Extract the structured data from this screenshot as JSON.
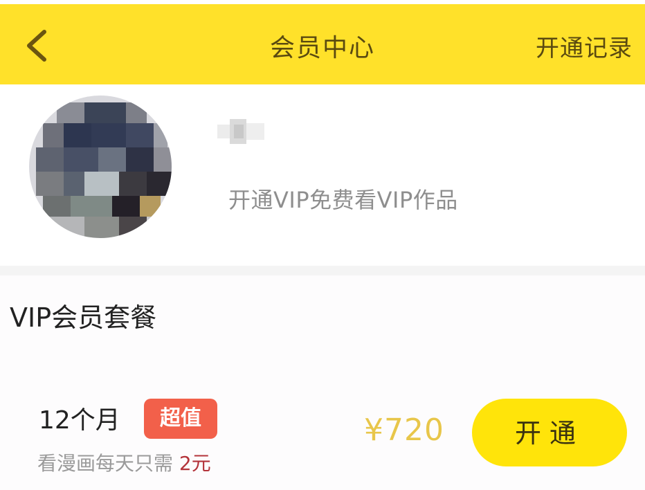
{
  "header": {
    "title": "会员中心",
    "action_label": "开通记录"
  },
  "profile": {
    "subtitle": "开通VIP免费看VIP作品"
  },
  "section": {
    "title": "VIP会员套餐"
  },
  "plans": [
    {
      "name": "12个月",
      "badge": "超值",
      "note_prefix": "看漫画每天只需",
      "note_value": "2元",
      "price": "¥720",
      "button_label": "开通"
    }
  ],
  "colors": {
    "header_bg": "#ffe12a",
    "badge_bg": "#f2604a",
    "price": "#e8c64a",
    "button_bg": "#ffe40a",
    "highlight": "#b3333a"
  }
}
